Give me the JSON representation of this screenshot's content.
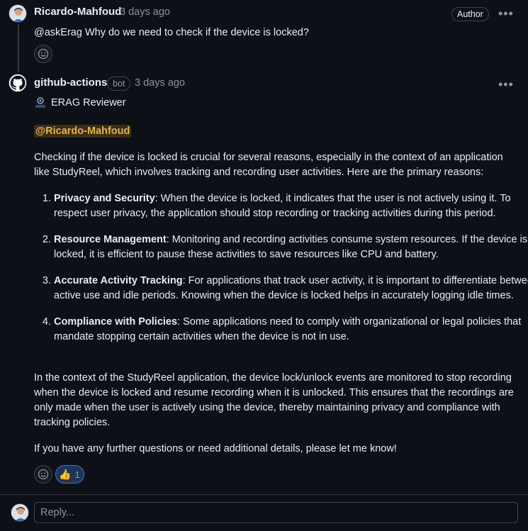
{
  "comments": [
    {
      "author": "Ricardo-Mahfoud",
      "time": "3 days ago",
      "badge": "Author",
      "more_icon": "kebab-horizontal-icon",
      "body": "@askErag Why do we need to check if the device is locked?"
    },
    {
      "author": "github-actions",
      "bot_badge": "bot",
      "time": "3 days ago",
      "more_icon": "kebab-horizontal-icon",
      "reviewer_label": "ERAG Reviewer",
      "mention": "@Ricardo-Mahfoud",
      "intro": "Checking if the device is locked is crucial for several reasons, especially in the context of an application like StudyReel, which involves tracking and recording user activities. Here are the primary reasons:",
      "reasons": [
        {
          "title": "Privacy and Security",
          "text": ": When the device is locked, it indicates that the user is not actively using it. To respect user privacy, the application should stop recording or tracking activities during this period."
        },
        {
          "title": "Resource Management",
          "text": ": Monitoring and recording activities consume system resources. If the device is locked, it is efficient to pause these activities to save resources like CPU and battery."
        },
        {
          "title": "Accurate Activity Tracking",
          "text": ": For applications that track user activity, it is important to differentiate between active use and idle periods. Knowing when the device is locked helps in accurately logging idle times."
        },
        {
          "title": "Compliance with Policies",
          "text": ": Some applications need to comply with organizational or legal policies that mandate stopping certain activities when the device is not in use."
        }
      ],
      "conclusion": "In the context of the StudyReel application, the device lock/unlock events are monitored to stop recording when the device is locked and resume recording when it is unlocked. This ensures that the recordings are only made when the user is actively using the device, thereby maintaining privacy and compliance with tracking policies.",
      "closing": "If you have any further questions or need additional details, please let me know!",
      "reactions": [
        {
          "icon": "thumbs-up-icon",
          "count": "1"
        }
      ]
    }
  ],
  "reply": {
    "placeholder": "Reply..."
  },
  "colors": {
    "background": "#0d1117",
    "mention": "#e3b341",
    "reaction_accent": "#58a6ff"
  }
}
